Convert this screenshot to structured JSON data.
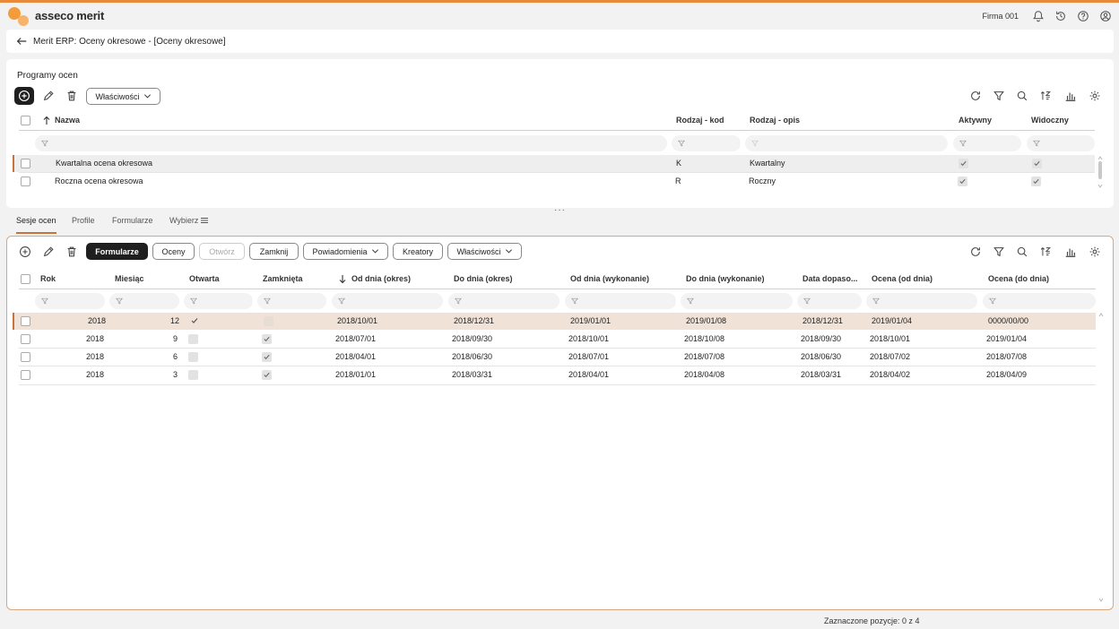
{
  "app": {
    "brand": "asseco merit",
    "company": "Firma 001"
  },
  "breadcrumb": {
    "title": "Merit ERP: Oceny okresowe - [Oceny okresowe]"
  },
  "programs": {
    "title": "Programy ocen",
    "properties_label": "Właściwości",
    "columns": {
      "name": "Nazwa",
      "kind_code": "Rodzaj - kod",
      "kind_desc": "Rodzaj - opis",
      "active": "Aktywny",
      "visible": "Widoczny"
    },
    "rows": [
      {
        "name": "Kwartalna ocena okresowa",
        "kind_code": "K",
        "kind_desc": "Kwartalny",
        "active": true,
        "visible": true
      },
      {
        "name": "Roczna ocena okresowa",
        "kind_code": "R",
        "kind_desc": "Roczny",
        "active": true,
        "visible": true
      }
    ]
  },
  "tabs": [
    {
      "label": "Sesje ocen",
      "active": true
    },
    {
      "label": "Profile",
      "active": false
    },
    {
      "label": "Formularze",
      "active": false
    },
    {
      "label": "Wybierz",
      "active": false
    }
  ],
  "sessions": {
    "buttons": {
      "forms": "Formularze",
      "ratings": "Oceny",
      "open": "Otwórz",
      "close": "Zamknij",
      "notifications": "Powiadomienia",
      "wizards": "Kreatory",
      "properties": "Właściwości"
    },
    "columns": {
      "year": "Rok",
      "month": "Miesiąc",
      "open": "Otwarta",
      "closed": "Zamknięta",
      "from_period": "Od dnia (okres)",
      "to_period": "Do dnia (okres)",
      "from_exec": "Od dnia (wykonanie)",
      "to_exec": "Do dnia (wykonanie)",
      "match_date": "Data dopaso...",
      "rating_from": "Ocena (od dnia)",
      "rating_to": "Ocena (do dnia)"
    },
    "rows": [
      {
        "year": "2018",
        "month": "12",
        "open": true,
        "closed": false,
        "from_period": "2018/10/01",
        "to_period": "2018/12/31",
        "from_exec": "2019/01/01",
        "to_exec": "2019/01/08",
        "match_date": "2018/12/31",
        "rating_from": "2019/01/04",
        "rating_to": "0000/00/00"
      },
      {
        "year": "2018",
        "month": "9",
        "open": false,
        "closed": true,
        "from_period": "2018/07/01",
        "to_period": "2018/09/30",
        "from_exec": "2018/10/01",
        "to_exec": "2018/10/08",
        "match_date": "2018/09/30",
        "rating_from": "2018/10/01",
        "rating_to": "2019/01/04"
      },
      {
        "year": "2018",
        "month": "6",
        "open": false,
        "closed": true,
        "from_period": "2018/04/01",
        "to_period": "2018/06/30",
        "from_exec": "2018/07/01",
        "to_exec": "2018/07/08",
        "match_date": "2018/06/30",
        "rating_from": "2018/07/02",
        "rating_to": "2018/07/08"
      },
      {
        "year": "2018",
        "month": "3",
        "open": false,
        "closed": true,
        "from_period": "2018/01/01",
        "to_period": "2018/03/31",
        "from_exec": "2018/04/01",
        "to_exec": "2018/04/08",
        "match_date": "2018/03/31",
        "rating_from": "2018/04/02",
        "rating_to": "2018/04/09"
      }
    ]
  },
  "status": {
    "selected": "Zaznaczone pozycje: 0 z 4"
  },
  "colors": {
    "accent": "#e88a3c",
    "selected_row": "#f1e2d7",
    "primary_button": "#1f1f1f"
  }
}
